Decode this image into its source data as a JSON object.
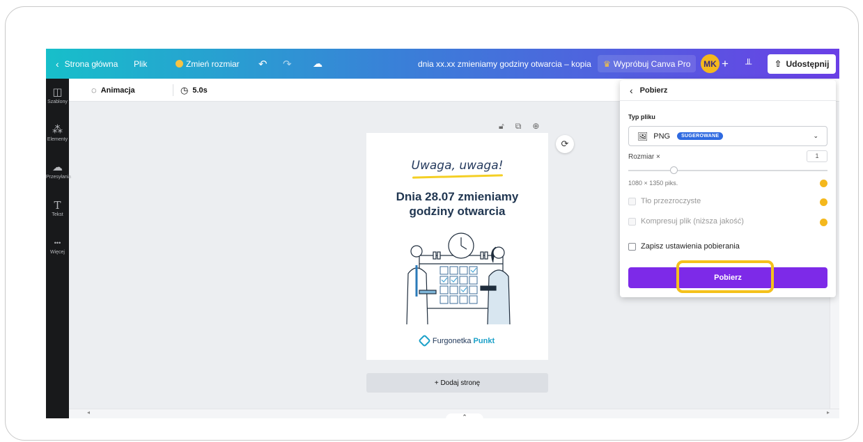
{
  "topbar": {
    "home": "Strona główna",
    "file": "Plik",
    "resize": "Zmień rozmiar",
    "undo_icon": "↶",
    "redo_icon": "↷",
    "cloud_icon": "☁",
    "doc_title": "dnia xx.xx zmieniamy godziny otwarcia – kopia",
    "try_pro": "Wypróbuj Canva Pro",
    "avatar": "MK",
    "share": "Udostępnij"
  },
  "sidebar": {
    "items": [
      {
        "icon": "◫",
        "label": "Szablony"
      },
      {
        "icon": "⁂",
        "label": "Elementy"
      },
      {
        "icon": "☁",
        "label": "Przesyłania"
      },
      {
        "icon": "T",
        "label": "Tekst"
      },
      {
        "icon": "•••",
        "label": "Więcej"
      }
    ]
  },
  "toolbar": {
    "animation": "Animacja",
    "duration": "5.0s"
  },
  "design": {
    "headline_top": "Uwaga, uwaga!",
    "headline_line1": "Dnia 28.07 zmieniamy",
    "headline_line2": "godziny otwarcia",
    "logo_name": "Furgonetka",
    "logo_accent": "Punkt"
  },
  "canvas": {
    "add_page": "+ Dodaj stronę"
  },
  "download_panel": {
    "title": "Pobierz",
    "file_type_label": "Typ pliku",
    "file_type": "PNG",
    "suggested_badge": "SUGEROWANE",
    "size_label": "Rozmiar ×",
    "size_value": "1",
    "size_scale_fraction": 0.23,
    "size_info": "1080 × 1350 piks.",
    "options": [
      {
        "label": "Tło przezroczyste",
        "checked": false,
        "pro": true
      },
      {
        "label": "Kompresuj plik (niższa jakość)",
        "checked": false,
        "pro": true
      },
      {
        "label": "Zapisz ustawienia pobierania",
        "checked": false,
        "pro": false
      }
    ],
    "download_button": "Pobierz"
  },
  "colors": {
    "accent": "#7d2ae8",
    "highlight": "#f4c11c",
    "pro_coin": "#f4b81d",
    "badge": "#2f6ae0"
  }
}
